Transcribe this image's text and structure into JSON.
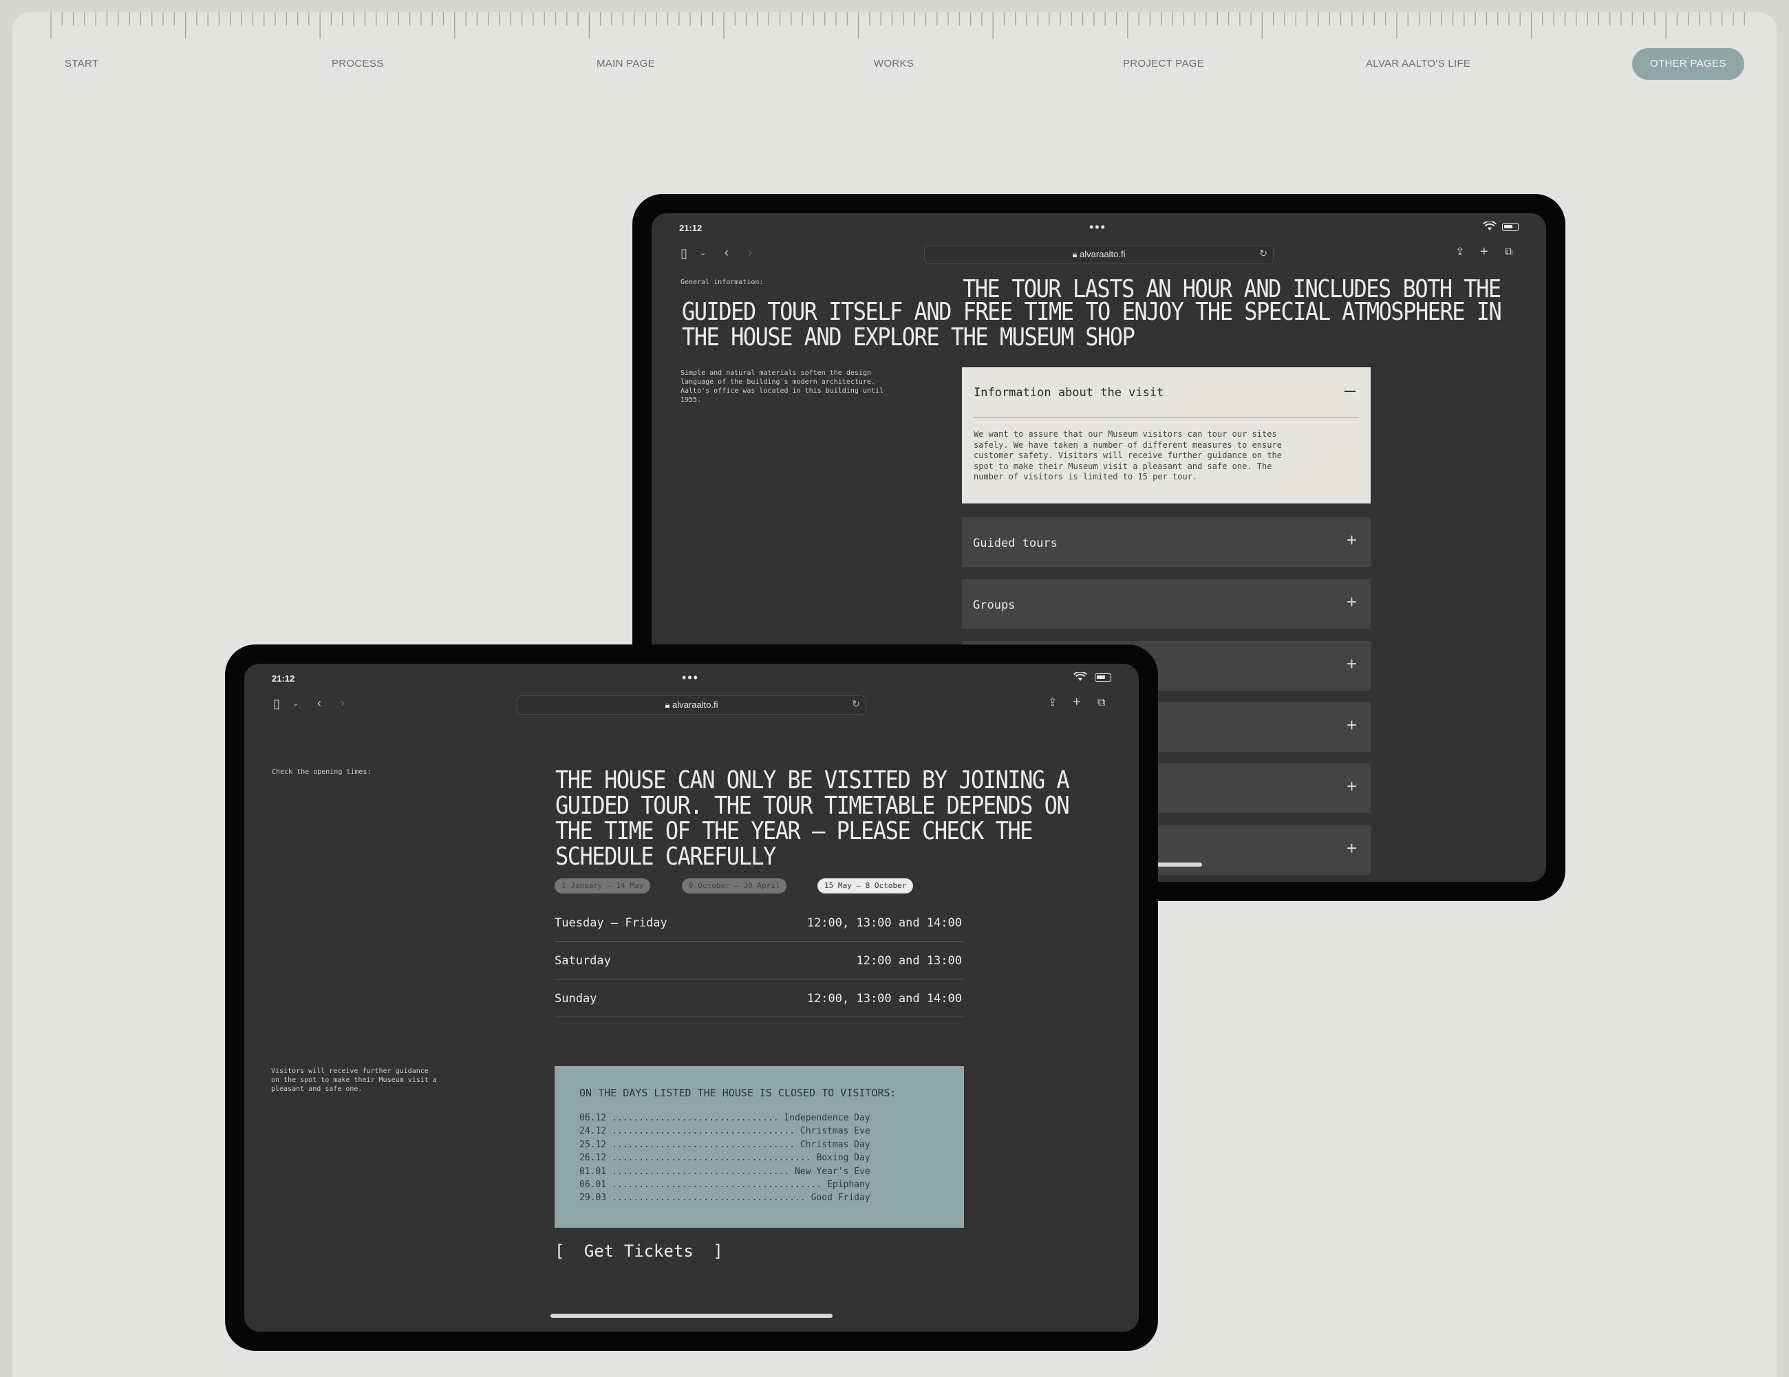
{
  "nav": [
    "START",
    "PROCESS",
    "MAIN PAGE",
    "WORKS",
    "PROJECT PAGE",
    "ALVAR AALTO'S LIFE",
    "OTHER PAGES"
  ],
  "nav_active": "OTHER PAGES",
  "colors": {
    "accent": "#8fa5a6",
    "page_bg": "#e3e3e1",
    "screen_bg": "#333333",
    "device": "#060606"
  },
  "back_tablet": {
    "time": "21:12",
    "url": "alvaraalto.fi",
    "label": "General information:",
    "headline_lead": "THE TOUR LASTS AN HOUR AND INCLUDES BOTH THE",
    "headline_rest": "GUIDED TOUR ITSELF AND FREE TIME TO ENJOY THE SPECIAL ATMOSPHERE IN THE HOUSE AND EXPLORE THE MUSEUM SHOP",
    "side_text": "Simple and natural materials soften the design language of the building's modern architecture. Aalto's office was located in this building until 1955.",
    "open_title": "Information about the visit",
    "open_body": "We want to assure that our Museum visitors can tour our sites safely. We have taken a number of different measures to ensure customer safety. Visitors will receive further guidance on the spot to make their Museum visit a pleasant and safe one. The number of visitors is limited to 15 per tour.",
    "collapsed": [
      "Guided tours",
      "Groups"
    ]
  },
  "front_tablet": {
    "time": "21:12",
    "url": "alvaraalto.fi",
    "label": "Check the opening times:",
    "headline": "THE HOUSE CAN ONLY BE VISITED BY JOINING A GUIDED TOUR. THE TOUR TIMETABLE DEPENDS ON THE TIME OF THE YEAR – PLEASE CHECK THE SCHEDULE CAREFULLY",
    "seasons": [
      "1 January – 14 May",
      "9 October – 30 April",
      "15 May – 8 October"
    ],
    "active_season": "15 May – 8 October",
    "schedule": [
      {
        "day": "Tuesday – Friday",
        "hours": "12:00, 13:00 and 14:00"
      },
      {
        "day": "Saturday",
        "hours": "12:00 and 13:00"
      },
      {
        "day": "Sunday",
        "hours": "12:00, 13:00 and 14:00"
      }
    ],
    "side_text": "Visitors will receive further guidance on the spot to make their Museum visit a pleasant and safe one.",
    "closed_title": "ON THE DAYS LISTED THE HOUSE IS CLOSED TO VISITORS:",
    "holidays": [
      {
        "date": "06.12",
        "name": "Independence Day"
      },
      {
        "date": "24.12",
        "name": "Christmas Eve"
      },
      {
        "date": "25.12",
        "name": "Christmas Day"
      },
      {
        "date": "26.12",
        "name": "Boxing Day"
      },
      {
        "date": "01.01",
        "name": "New Year's Eve"
      },
      {
        "date": "06.01",
        "name": "Epiphany"
      },
      {
        "date": "29.03",
        "name": "Good Friday"
      }
    ],
    "tickets_open": "[",
    "tickets_label": "Get Tickets",
    "tickets_close": "]"
  }
}
